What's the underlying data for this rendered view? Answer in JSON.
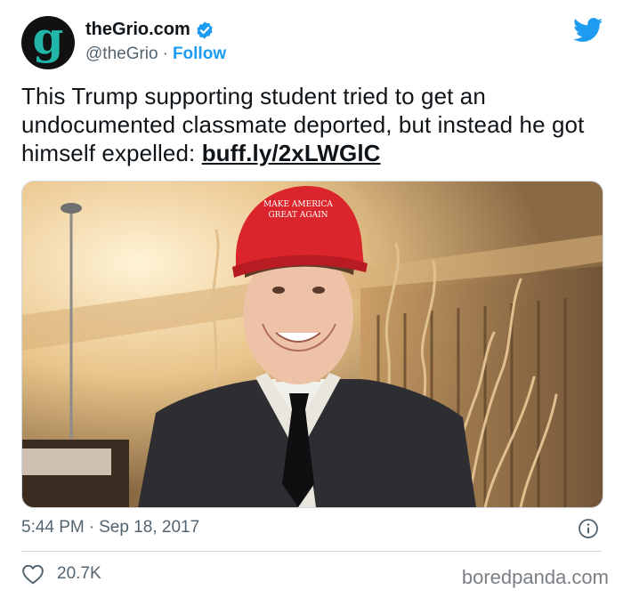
{
  "tweet": {
    "display_name": "theGrio.com",
    "avatar_letter": "g",
    "handle": "@theGrio",
    "separator": "·",
    "follow_label": "Follow",
    "text": "This Trump supporting student tried to get an undocumented classmate deported, but instead he got himself expelled: ",
    "link_text": "buff.ly/2xLWGlC",
    "photo_cap_text_line1": "MAKE AMERICA",
    "photo_cap_text_line2": "GREAT AGAIN",
    "time": "5:44 PM",
    "date": "Sep 18, 2017",
    "like_count": "20.7K"
  },
  "watermark": "boredpanda.com",
  "icons": {
    "verified": "verified-badge-icon",
    "platform": "twitter-bird-icon",
    "info": "info-icon",
    "like": "heart-icon"
  },
  "colors": {
    "accent": "#1d9bf0",
    "avatar_bg": "#111111",
    "avatar_letter": "#22b6a8",
    "muted_text": "#536471"
  }
}
